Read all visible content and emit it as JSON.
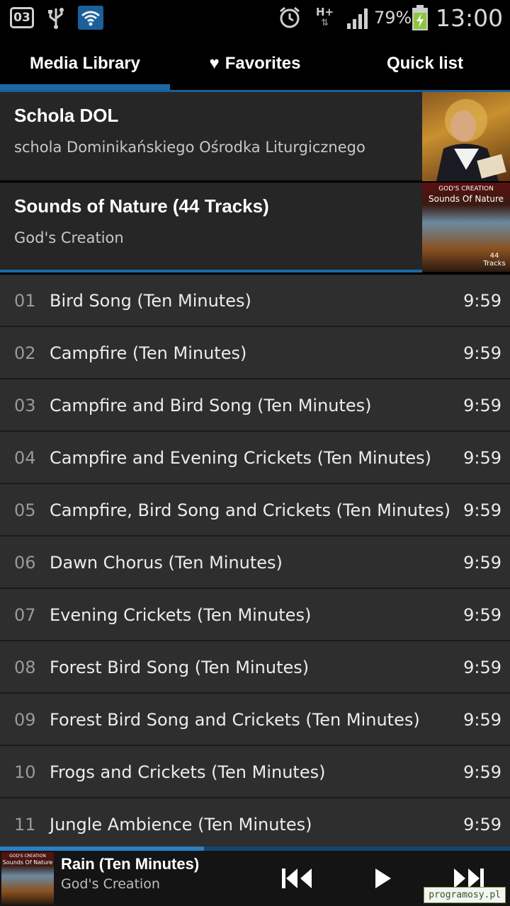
{
  "status_bar": {
    "calendar_day": "03",
    "battery_percent": "79%",
    "network": "H+",
    "time": "13:00",
    "icons": [
      "calendar-icon",
      "usb-icon",
      "wifi-icon",
      "alarm-icon",
      "network-icon",
      "signal-icon",
      "battery-icon"
    ]
  },
  "tabs": [
    {
      "label": "Media Library",
      "active": true
    },
    {
      "label": "Favorites",
      "icon": "heart-icon",
      "active": false
    },
    {
      "label": "Quick list",
      "active": false
    }
  ],
  "albums": [
    {
      "title": "Schola DOL",
      "artist": "schola Dominikańskiego Ośrodka Liturgicznego"
    },
    {
      "title": "Sounds of Nature (44 Tracks)",
      "artist": "God's Creation",
      "art_text_top": "GOD'S CREATION",
      "art_text_title": "Sounds Of Nature",
      "art_text_badge": "44 Tracks"
    }
  ],
  "tracks": [
    {
      "num": "01",
      "name": "Bird Song (Ten Minutes)",
      "duration": "9:59"
    },
    {
      "num": "02",
      "name": "Campfire (Ten Minutes)",
      "duration": "9:59"
    },
    {
      "num": "03",
      "name": "Campfire and Bird Song (Ten Minutes)",
      "duration": "9:59"
    },
    {
      "num": "04",
      "name": "Campfire and Evening Crickets (Ten Minutes)",
      "duration": "9:59"
    },
    {
      "num": "05",
      "name": "Campfire, Bird Song and Crickets (Ten Minutes)",
      "duration": "9:59"
    },
    {
      "num": "06",
      "name": "Dawn Chorus (Ten Minutes)",
      "duration": "9:59"
    },
    {
      "num": "07",
      "name": "Evening Crickets (Ten Minutes)",
      "duration": "9:59"
    },
    {
      "num": "08",
      "name": "Forest Bird Song (Ten Minutes)",
      "duration": "9:59"
    },
    {
      "num": "09",
      "name": "Forest Bird Song and Crickets (Ten Minutes)",
      "duration": "9:59"
    },
    {
      "num": "10",
      "name": "Frogs and Crickets (Ten Minutes)",
      "duration": "9:59"
    },
    {
      "num": "11",
      "name": "Jungle Ambience (Ten Minutes)",
      "duration": "9:59"
    }
  ],
  "now_playing": {
    "title": "Rain (Ten Minutes)",
    "artist": "God's Creation",
    "progress": 0.4,
    "controls": [
      "previous-icon",
      "play-icon",
      "next-icon"
    ]
  },
  "watermark": "programosy.pl",
  "colors": {
    "accent": "#1b6aa6",
    "background": "#000000",
    "row": "#2e2e2e"
  }
}
